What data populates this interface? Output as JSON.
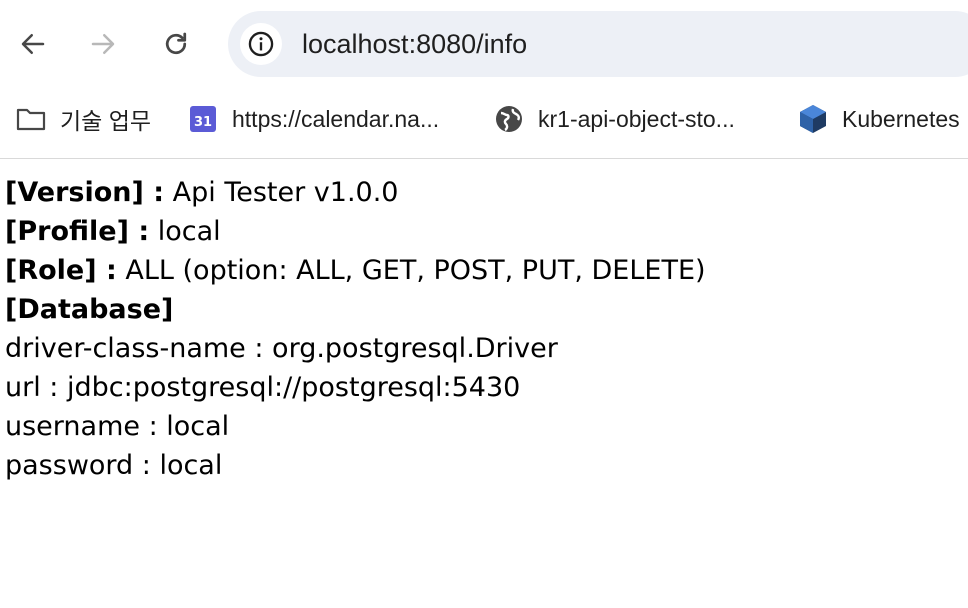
{
  "toolbar": {
    "back_icon": "arrow-left-icon",
    "forward_icon": "arrow-right-icon",
    "reload_icon": "reload-icon",
    "url": "localhost:8080/info"
  },
  "bookmarks": [
    {
      "label": "기술 업무",
      "icon": "folder-icon"
    },
    {
      "label": "https://calendar.na...",
      "icon": "calendar-icon",
      "icon_text": "31"
    },
    {
      "label": "kr1-api-object-sto...",
      "icon": "globe-icon"
    },
    {
      "label": "Kubernetes",
      "icon": "kubernetes-icon"
    }
  ],
  "info": {
    "version_label": "[Version] :",
    "version_value": "Api Tester v1.0.0",
    "profile_label": "[Profile] :",
    "profile_value": "local",
    "role_label": "[Role] :",
    "role_value": "ALL (option: ALL, GET, POST, PUT, DELETE)",
    "database_label": "[Database]",
    "driver_line": "driver-class-name : org.postgresql.Driver",
    "url_line": "url : jdbc:postgresql://postgresql:5430",
    "username_line": "username : local",
    "password_line": "password : local"
  },
  "colors": {
    "omnibox_bg": "#edf0f6",
    "calendar_icon": "#5b5bd6",
    "kubernetes_dark": "#1f3b63",
    "kubernetes_light": "#4a86d9"
  }
}
